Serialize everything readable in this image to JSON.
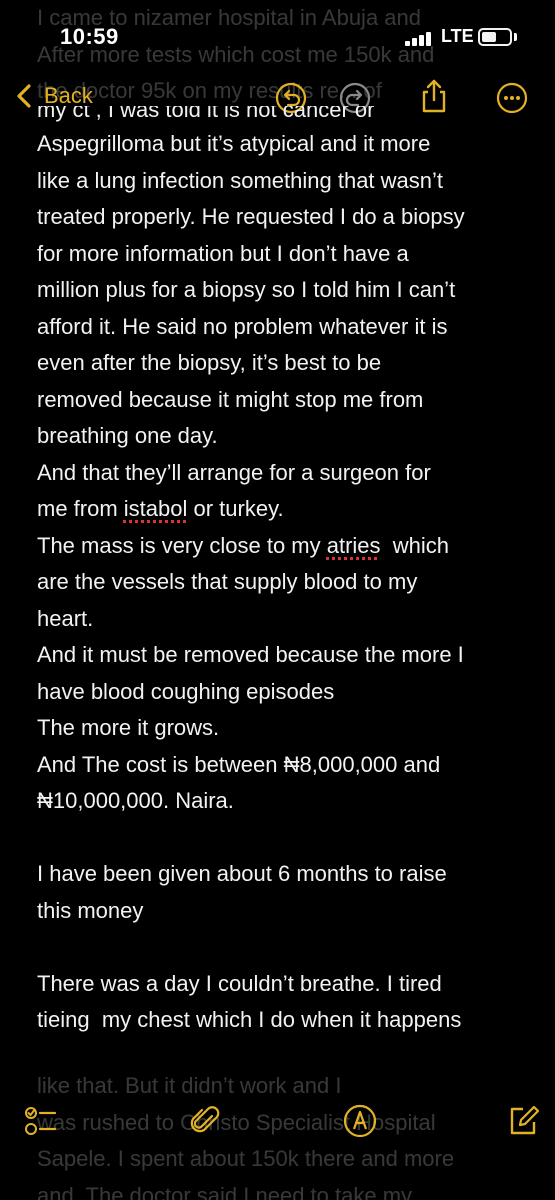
{
  "status_bar": {
    "time": "10:59",
    "network": "LTE",
    "signal_bars": 4
  },
  "nav": {
    "back_label": "Back",
    "accent_color": "#e3b224"
  },
  "ghost_top_lines": [
    "I came to nizamer hospital in Abuja and",
    "After more tests which cost me 150k and",
    "the doctor 95k on my results re... of"
  ],
  "note": {
    "cut_line": "my ct , I was told it is not cancer or",
    "lines": [
      "Aspegrilloma but it’s atypical and it more",
      "like a lung infection something that wasn’t",
      "treated properly. He requested I do a biopsy",
      "for more information but I don’t have a",
      "million plus for a biopsy so I told him I can’t",
      "afford it. He said no problem whatever it is",
      "even after the biopsy, it’s best to be",
      "removed because it might stop me from",
      "breathing one day.",
      "And that they’ll arrange for a surgeon for",
      {
        "pre": "me from ",
        "misspelled": "istabol",
        "post": " or turkey."
      },
      {
        "pre": "The mass is very close to my ",
        "misspelled": "atries",
        "post": "  which"
      },
      "are the vessels that supply blood to my",
      "heart.",
      "And it must be removed because the more I",
      "have blood coughing episodes",
      "The more it grows.",
      "And The cost is between ₦8,000,000 and",
      "₦10,000,000. Naira.",
      "",
      "I have been given about 6 months to raise",
      "this money",
      "",
      "There was a day I couldn’t breathe. I tired",
      "tieing  my chest which I do when it happens"
    ]
  },
  "ghost_bottom_lines": [
    "like that. But it didn’t work and I",
    "was rushed to Christo Specialist Hospital",
    "Sapele. I spent about 150k there and more",
    "and. The doctor said I need to take my"
  ],
  "toolbar": {
    "accent_color": "#e3b224"
  }
}
